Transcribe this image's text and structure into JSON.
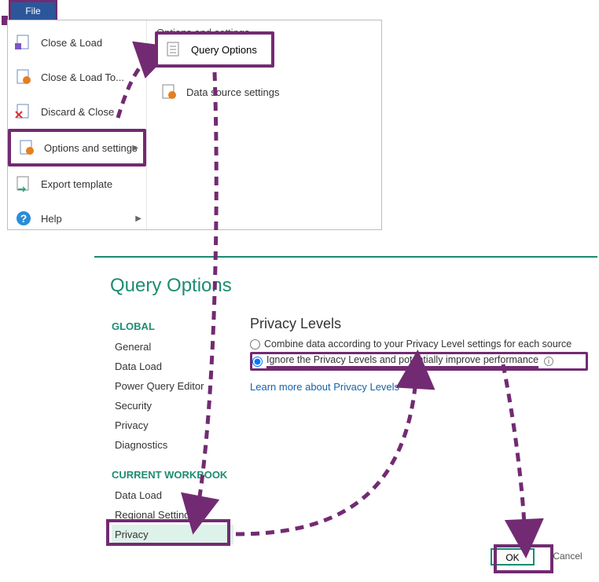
{
  "file_tab": "File",
  "menu": {
    "close_load": "Close & Load",
    "close_load_to": "Close & Load To...",
    "discard_close": "Discard & Close",
    "options_settings": "Options and settings",
    "export_template": "Export template",
    "help": "Help"
  },
  "submenu": {
    "header": "Options and settings",
    "query_options": "Query Options",
    "data_source_settings": "Data source settings"
  },
  "dialog": {
    "title": "Query Options",
    "global_header": "GLOBAL",
    "global_items": [
      "General",
      "Data Load",
      "Power Query Editor",
      "Security",
      "Privacy",
      "Diagnostics"
    ],
    "workbook_header": "CURRENT WORKBOOK",
    "workbook_items": [
      "Data Load",
      "Regional Settings",
      "Privacy"
    ],
    "panel_header": "Privacy Levels",
    "radio1": "Combine data according to your Privacy Level settings for each source",
    "radio2": "Ignore the Privacy Levels and potentially improve performance",
    "learn_more": "Learn more about Privacy Levels",
    "ok": "OK",
    "cancel": "Cancel"
  }
}
